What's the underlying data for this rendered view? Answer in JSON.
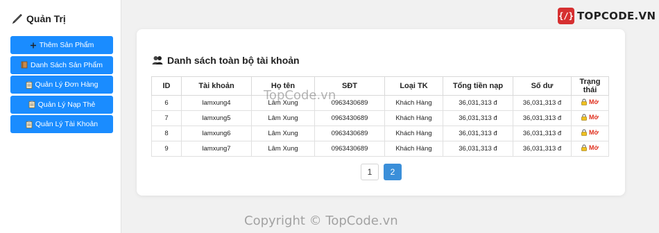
{
  "sidebar": {
    "title": "Quản Trị",
    "items": [
      {
        "label": "Thêm Sản Phẩm",
        "icon": "plus-icon"
      },
      {
        "label": "Danh Sách Sản Phẩm",
        "icon": "book-icon"
      },
      {
        "label": "Quản Lý Đơn Hàng",
        "icon": "clipboard-icon"
      },
      {
        "label": "Quản Lý Nạp Thẻ",
        "icon": "clipboard-icon"
      },
      {
        "label": "Quản Lý Tài Khoản",
        "icon": "clipboard-icon"
      }
    ]
  },
  "panel": {
    "title": "Danh sách toàn bộ tài khoản",
    "columns": [
      "ID",
      "Tài khoản",
      "Họ tên",
      "SĐT",
      "Loại TK",
      "Tổng tiền nạp",
      "Số dư",
      "Trạng thái"
    ],
    "rows": [
      [
        "6",
        "lamxung4",
        "Lâm Xung",
        "0963430689",
        "Khách Hàng",
        "36,031,313 đ",
        "36,031,313 đ",
        "Mở"
      ],
      [
        "7",
        "lamxung5",
        "Lâm Xung",
        "0963430689",
        "Khách Hàng",
        "36,031,313 đ",
        "36,031,313 đ",
        "Mở"
      ],
      [
        "8",
        "lamxung6",
        "Lâm Xung",
        "0963430689",
        "Khách Hàng",
        "36,031,313 đ",
        "36,031,313 đ",
        "Mở"
      ],
      [
        "9",
        "lamxung7",
        "Lâm Xung",
        "0963430689",
        "Khách Hàng",
        "36,031,313 đ",
        "36,031,313 đ",
        "Mở"
      ]
    ],
    "pagination": {
      "pages": [
        "1",
        "2"
      ],
      "current": "2"
    }
  },
  "branding": {
    "logo_text": "TOPCODE.VN",
    "watermark_center": "TopCode.vn",
    "watermark_bottom": "Copyright © TopCode.vn"
  },
  "colors": {
    "accent": "#1a8cff",
    "pagination_active": "#3b8fd9",
    "status_open": "#e0301e",
    "logo": "#d63031"
  }
}
